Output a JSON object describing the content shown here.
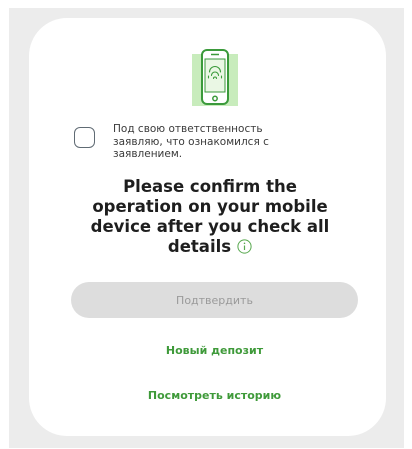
{
  "consent": {
    "checked": false,
    "text": "Под свою ответственность\nзаявляю, что ознакомился с\nзаявлением."
  },
  "confirmation": {
    "message": "Please confirm the\noperation on your mobile\ndevice after you check all\ndetails",
    "info_icon": "info-circle-icon"
  },
  "device_icon": "smartphone-fingerprint-icon",
  "actions": {
    "confirm_label": "Подтвердить",
    "confirm_enabled": false,
    "new_deposit_label": "Новый депозит",
    "view_history_label": "Посмотреть историю"
  },
  "colors": {
    "accent": "#3f9a3a",
    "disabled_button_bg": "#dddddd",
    "disabled_button_text": "#9a9a9a",
    "background_panel": "#ececec"
  }
}
